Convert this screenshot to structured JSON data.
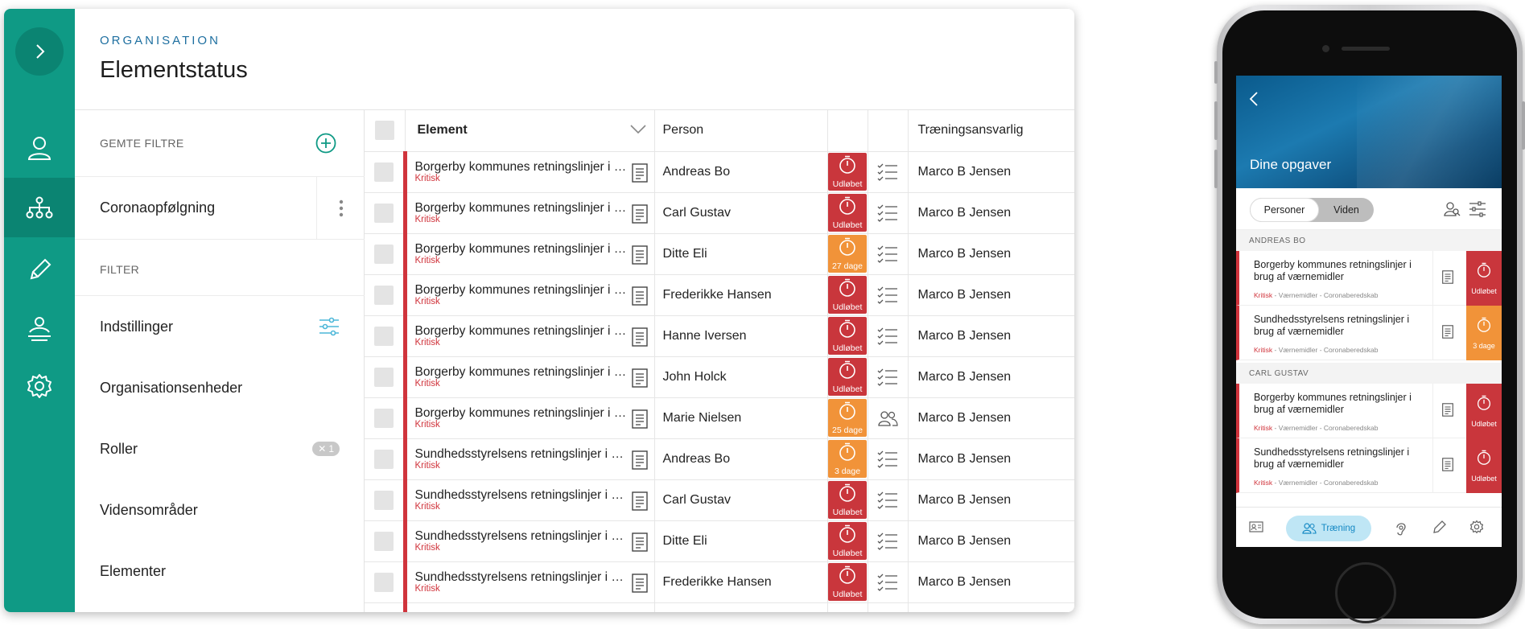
{
  "colors": {
    "rail": "#0f9a85",
    "rail_active": "#0b8472",
    "critical": "#d0343c",
    "overdue": "#c9363c",
    "soon": "#f19339",
    "kicker": "#1e6fa0"
  },
  "header": {
    "kicker": "ORGANISATION",
    "title": "Elementstatus"
  },
  "rail": {
    "icons": [
      "chevron-right-icon",
      "user-icon",
      "org-tree-icon",
      "pencil-icon",
      "training-icon",
      "gear-icon"
    ]
  },
  "filters": {
    "saved_label": "GEMTE FILTRE",
    "saved_item": "Coronaopfølgning",
    "filter_label": "FILTER",
    "items": [
      {
        "label": "Indstillinger"
      },
      {
        "label": "Organisationsenheder"
      },
      {
        "label": "Roller",
        "chip": "1"
      },
      {
        "label": "Vidensområder"
      },
      {
        "label": "Elementer"
      }
    ]
  },
  "table": {
    "columns": {
      "element": "Element",
      "person": "Person",
      "status": "",
      "type": "",
      "owner": "Træningsansvarlig"
    },
    "critical_label": "Kritisk",
    "rows": [
      {
        "element": "Borgerby kommunes retningslinjer i brug af værnemidler",
        "person": "Andreas Bo",
        "status": "overdue",
        "status_text": "Udløbet",
        "type": "checklist",
        "owner": "Marco B Jensen"
      },
      {
        "element": "Borgerby kommunes retningslinjer i brug af værnemidler",
        "person": "Carl Gustav",
        "status": "overdue",
        "status_text": "Udløbet",
        "type": "checklist",
        "owner": "Marco B Jensen"
      },
      {
        "element": "Borgerby kommunes retningslinjer i brug af værnemidler",
        "person": "Ditte Eli",
        "status": "soon",
        "status_text": "27 dage",
        "type": "checklist",
        "owner": "Marco B Jensen"
      },
      {
        "element": "Borgerby kommunes retningslinjer i brug af værnemidler",
        "person": "Frederikke Hansen",
        "status": "overdue",
        "status_text": "Udløbet",
        "type": "checklist",
        "owner": "Marco B Jensen"
      },
      {
        "element": "Borgerby kommunes retningslinjer i brug af værnemidler",
        "person": "Hanne Iversen",
        "status": "overdue",
        "status_text": "Udløbet",
        "type": "checklist",
        "owner": "Marco B Jensen"
      },
      {
        "element": "Borgerby kommunes retningslinjer i brug af værnemidler",
        "person": "John Holck",
        "status": "overdue",
        "status_text": "Udløbet",
        "type": "checklist",
        "owner": "Marco B Jensen"
      },
      {
        "element": "Borgerby kommunes retningslinjer i brug af værnemidler",
        "person": "Marie Nielsen",
        "status": "soon",
        "status_text": "25 dage",
        "type": "people",
        "owner": "Marco B Jensen"
      },
      {
        "element": "Sundhedsstyrelsens retningslinjer i brug af værnemidler",
        "person": "Andreas Bo",
        "status": "soon",
        "status_text": "3 dage",
        "type": "checklist",
        "owner": "Marco B Jensen"
      },
      {
        "element": "Sundhedsstyrelsens retningslinjer i brug af værnemidler",
        "person": "Carl Gustav",
        "status": "overdue",
        "status_text": "Udløbet",
        "type": "checklist",
        "owner": "Marco B Jensen"
      },
      {
        "element": "Sundhedsstyrelsens retningslinjer i brug af værnemidler",
        "person": "Ditte Eli",
        "status": "overdue",
        "status_text": "Udløbet",
        "type": "checklist",
        "owner": "Marco B Jensen"
      },
      {
        "element": "Sundhedsstyrelsens retningslinjer i brug af værnemidler",
        "person": "Frederikke Hansen",
        "status": "overdue",
        "status_text": "Udløbet",
        "type": "checklist",
        "owner": "Marco B Jensen"
      }
    ]
  },
  "mobile": {
    "title": "Dine opgaver",
    "segments": [
      "Personer",
      "Viden"
    ],
    "meta_rest": " - Værnemidler - Coronaberedskab",
    "groups": [
      {
        "name": "ANDREAS BO",
        "tasks": [
          {
            "name": "Borgerby kommunes retningslinjer i brug af værnemidler",
            "status": "overdue",
            "status_text": "Udløbet"
          },
          {
            "name": "Sundhedsstyrelsens retningslinjer i brug af værnemidler",
            "status": "soon",
            "status_text": "3 dage"
          }
        ]
      },
      {
        "name": "CARL GUSTAV",
        "tasks": [
          {
            "name": "Borgerby kommunes retningslinjer i brug af værnemidler",
            "status": "overdue",
            "status_text": "Udløbet"
          },
          {
            "name": "Sundhedsstyrelsens retningslinjer i brug af værnemidler",
            "status": "overdue",
            "status_text": "Udløbet"
          }
        ]
      }
    ],
    "nav": {
      "active_label": "Træning"
    }
  }
}
